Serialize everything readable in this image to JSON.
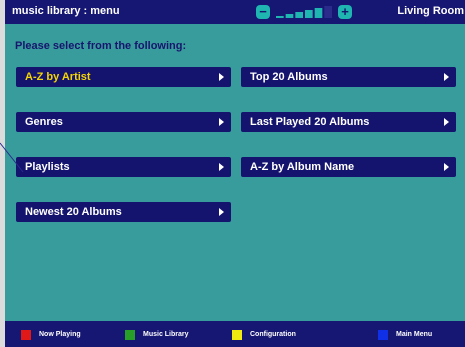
{
  "header": {
    "title": "music library : menu",
    "room": "Living Room",
    "volume": {
      "minus_symbol": "−",
      "plus_symbol": "+",
      "level": 5,
      "max": 6
    }
  },
  "prompt": "Please select from the following:",
  "menu": {
    "a_z_artist": "A-Z by Artist",
    "top_20_albums": "Top 20 Albums",
    "genres": "Genres",
    "last_played_20": "Last Played 20 Albums",
    "playlists": "Playlists",
    "a_z_album_name": "A-Z by Album Name",
    "newest_20": "Newest 20 Albums",
    "selected_item": "A-Z by Artist"
  },
  "footer": {
    "now_playing": "Now Playing",
    "music_library": "Music Library",
    "configuration": "Configuration",
    "main_menu": "Main Menu"
  },
  "colors": {
    "frame": "#1e1e82",
    "content_bg": "#389c9c",
    "button": "#14146e",
    "selected_text": "#f5d600",
    "red": "#e01818",
    "green": "#28a028",
    "yellow": "#f0ea10",
    "blue": "#1030e8"
  }
}
